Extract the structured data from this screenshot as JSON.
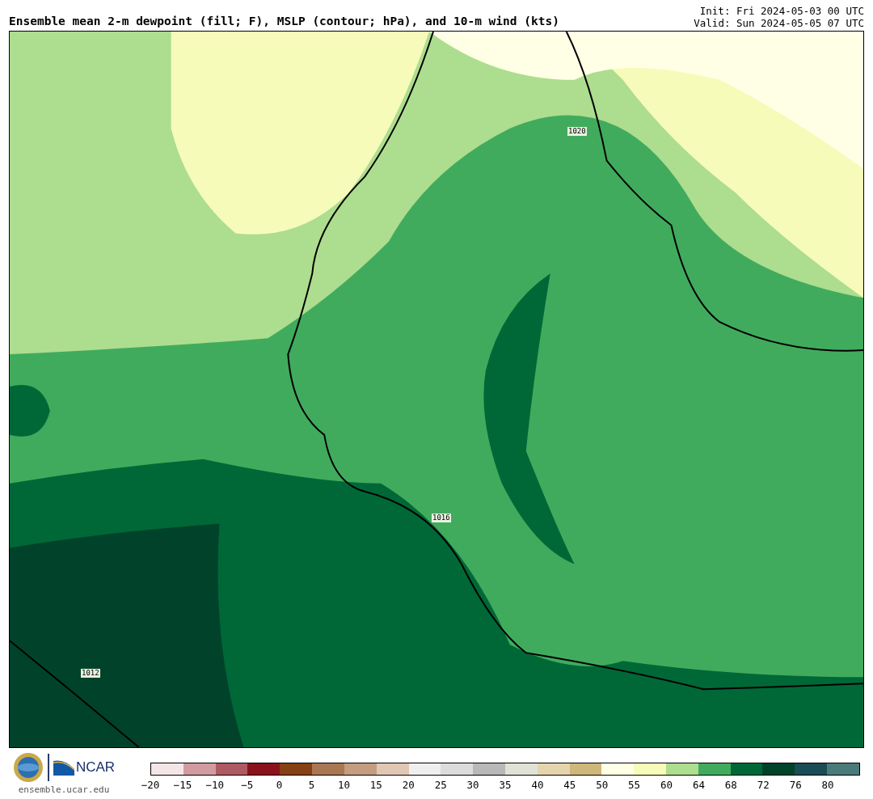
{
  "title": "Ensemble mean 2-m dewpoint (fill; F), MSLP (contour; hPa), and 10-m wind (kts)",
  "init": "Init: Fri 2024-05-03 00 UTC",
  "valid": "Valid: Sun 2024-05-05 07 UTC",
  "map": {
    "contour_labels": [
      "1020",
      "1016",
      "1012"
    ]
  },
  "site": "ensemble.ucar.edu",
  "logo_text": "NCAR",
  "colorbar": {
    "segments": [
      {
        "color": "#f4e6e6"
      },
      {
        "color": "#d29ba0"
      },
      {
        "color": "#ad5a62"
      },
      {
        "color": "#8a121c"
      },
      {
        "color": "#854114"
      },
      {
        "color": "#a97753"
      },
      {
        "color": "#c49c7f"
      },
      {
        "color": "#e0c7b4"
      },
      {
        "color": "#efefef"
      },
      {
        "color": "#dcdcdc"
      },
      {
        "color": "#b8b8b8"
      },
      {
        "color": "#e0e2d5"
      },
      {
        "color": "#e5d4ad"
      },
      {
        "color": "#cdb77a"
      },
      {
        "color": "#ffffe5"
      },
      {
        "color": "#f7fbb9"
      },
      {
        "color": "#addd8e"
      },
      {
        "color": "#41ab5d"
      },
      {
        "color": "#006837"
      },
      {
        "color": "#00432a"
      },
      {
        "color": "#1a4c55"
      },
      {
        "color": "#4b7a7a"
      }
    ],
    "ticks": [
      "−20",
      "−15",
      "−10",
      "−5",
      "0",
      "5",
      "10",
      "15",
      "20",
      "25",
      "30",
      "35",
      "40",
      "45",
      "50",
      "55",
      "60",
      "64",
      "68",
      "72",
      "76",
      "80"
    ]
  }
}
